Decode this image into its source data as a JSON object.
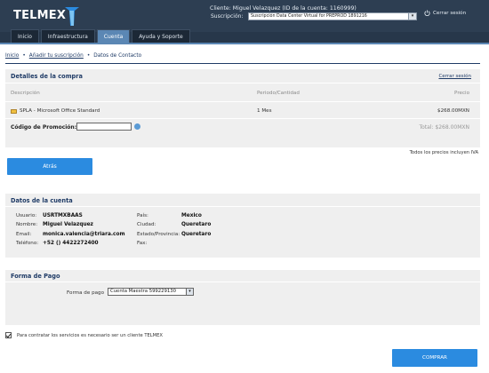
{
  "header": {
    "logo_text": "TELMEX",
    "client_line": "Cliente: Miguel Velazquez (ID de la cuenta: 1160999)",
    "subscription_label": "Suscripción:",
    "subscription_value": "Suscripción Data Center Virtual for PREPROD 1891216",
    "logout_label": "Cerrar sesión",
    "colors": {
      "header_bg": "#27374a",
      "accent": "#5b87b4",
      "button": "#2b8be0"
    }
  },
  "tabs": [
    {
      "label": "Inicio",
      "active": false
    },
    {
      "label": "Infraestructura",
      "active": false
    },
    {
      "label": "Cuenta",
      "active": true
    },
    {
      "label": "Ayuda y Soporte",
      "active": false
    }
  ],
  "breadcrumb": {
    "home": "Inicio",
    "add": "Añadir tu suscripción",
    "current": "Datos de Contacto"
  },
  "purchase": {
    "title": "Detalles de la compra",
    "close_session": "Cerrar sesión",
    "columns": {
      "description": "Descripción",
      "period": "Periodo/Cantidad",
      "price": "Precio"
    },
    "item": {
      "icon": "box-icon",
      "name": "SPLA - Microsoft Office Standard",
      "period": "1 Mes",
      "price": "$268.00MXN"
    },
    "promo_label": "Código de Promoción:",
    "promo_value": "",
    "total": "Total: $268.00MXN",
    "iva_note": "Todos los precios incluyen IVA"
  },
  "back_button": "Atrás",
  "account": {
    "title": "Datos de la cuenta",
    "left": [
      {
        "label": "Usuario:",
        "value": "USRTMXBAAS"
      },
      {
        "label": "Nombre:",
        "value": "Miguel Velazquez"
      },
      {
        "label": "Email:",
        "value": "monica.valencia@triara.com"
      },
      {
        "label": "Teléfono:",
        "value": "+52 () 4422272400"
      }
    ],
    "right": [
      {
        "label": "País:",
        "value": "Mexico"
      },
      {
        "label": "Ciudad:",
        "value": "Queretaro"
      },
      {
        "label": "Estado/Provincia:",
        "value": "Queretaro"
      },
      {
        "label": "Fax:",
        "value": ""
      }
    ]
  },
  "payment": {
    "title": "Forma de Pago",
    "label": "Forma de pago",
    "selected": "Cuenta Maestra 599229130"
  },
  "terms_text": "Para contratar los servicios es necesario ser un cliente TELMEX",
  "terms_checked": true,
  "buy_button": "COMPRAR"
}
